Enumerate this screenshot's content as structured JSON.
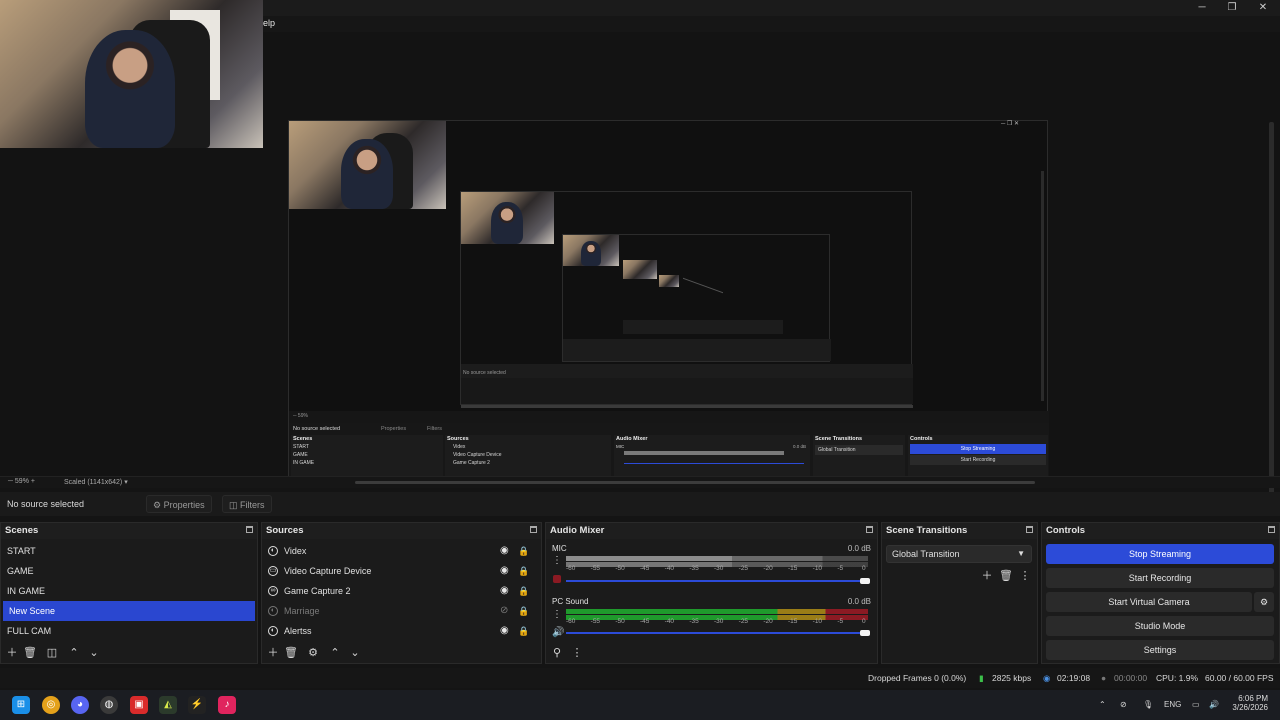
{
  "window": {
    "menu_help": "elp",
    "min": "─",
    "max": "❐",
    "close": "✕"
  },
  "preview": {
    "zoom": "59%",
    "scaled": "Scaled (1141x642)",
    "nested": {
      "no_source": "No source selected",
      "properties": "Properties",
      "filters": "Filters",
      "scenes_title": "Scenes",
      "sources_title": "Sources",
      "mixer_title": "Audio Mixer",
      "transitions_title": "Scene Transitions",
      "controls_title": "Controls",
      "scenes": [
        "START",
        "GAME",
        "IN GAME"
      ],
      "sources": [
        "Videx",
        "Video Capture Device",
        "Game Capture 2"
      ],
      "transition": "Global Transition",
      "stop": "Stop Streaming",
      "rec": "Start Recording",
      "mic": "MIC",
      "mic_db": "0.0 dB"
    }
  },
  "context": {
    "no_source": "No source selected",
    "properties": "Properties",
    "filters": "Filters"
  },
  "scenes": {
    "title": "Scenes",
    "items": [
      "START",
      "GAME",
      "IN GAME",
      "New Scene",
      "FULL CAM"
    ],
    "selected": "New Scene"
  },
  "sources": {
    "title": "Sources",
    "items": [
      {
        "label": "Videx",
        "icon": "browser-icon",
        "hidden": false
      },
      {
        "label": "Video Capture Device",
        "icon": "camera-icon",
        "hidden": false
      },
      {
        "label": "Game Capture 2",
        "icon": "gamepad-icon",
        "hidden": false
      },
      {
        "label": "Marriage",
        "icon": "browser-icon",
        "hidden": true
      },
      {
        "label": "Alertss",
        "icon": "browser-icon",
        "hidden": false
      }
    ]
  },
  "mixer": {
    "title": "Audio Mixer",
    "scale": [
      "-60",
      "-55",
      "-50",
      "-45",
      "-40",
      "-35",
      "-30",
      "-25",
      "-20",
      "-15",
      "-10",
      "-5",
      "0"
    ],
    "channels": [
      {
        "name": "MIC",
        "db": "0.0 dB"
      },
      {
        "name": "PC Sound",
        "db": "0.0 dB"
      }
    ]
  },
  "transitions": {
    "title": "Scene Transitions",
    "selected": "Global Transition"
  },
  "controls": {
    "title": "Controls",
    "stop_streaming": "Stop Streaming",
    "start_recording": "Start Recording",
    "start_virtual_camera": "Start Virtual Camera",
    "studio_mode": "Studio Mode",
    "settings": "Settings"
  },
  "status": {
    "dropped": "Dropped Frames 0 (0.0%)",
    "kbps": "2825 kbps",
    "stream_time": "02:19:08",
    "rec_time": "00:00:00",
    "cpu": "CPU: 1.9%",
    "fps": "60.00 / 60.00 FPS"
  },
  "taskbar": {
    "lang": "ENG",
    "time": "6:06 PM",
    "date": "3/26/2026"
  },
  "colors": {
    "accent": "#2c4bd8",
    "panel": "#1b1b1b",
    "background": "#141414"
  }
}
